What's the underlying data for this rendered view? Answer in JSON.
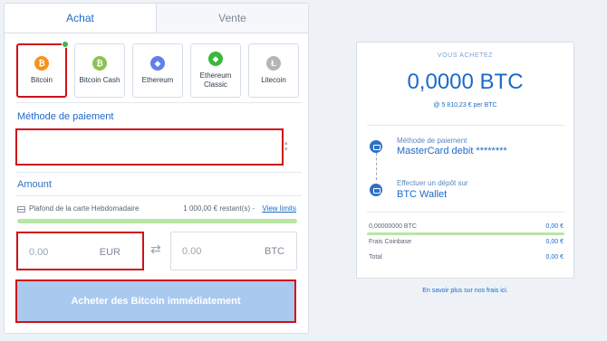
{
  "tabs": {
    "buy": "Achat",
    "sell": "Vente"
  },
  "coins": [
    {
      "label": "Bitcoin",
      "symbol": "₿",
      "color": "#f7931a",
      "selected": true
    },
    {
      "label": "Bitcoin Cash",
      "symbol": "₿",
      "color": "#8dc351",
      "selected": false
    },
    {
      "label": "Ethereum",
      "symbol": "◆",
      "color": "#627eea",
      "selected": false
    },
    {
      "label": "Ethereum Classic",
      "symbol": "◆",
      "color": "#3ab83a",
      "selected": false
    },
    {
      "label": "Litecoin",
      "symbol": "Ł",
      "color": "#b5b5b5",
      "selected": false
    }
  ],
  "payment": {
    "label": "Méthode de paiement",
    "value": ""
  },
  "amount": {
    "label": "Amount",
    "limit_label": "Plafond de la carte Hebdomadaire",
    "limit_amount": "1 000,00 € restant(s) -",
    "view_limits": "View limits",
    "limit_remaining_fraction": 1.0,
    "eur_value": "0.00",
    "eur_currency": "EUR",
    "btc_value": "0.00",
    "btc_currency": "BTC"
  },
  "buy_button": "Acheter des Bitcoin immédiatement",
  "summary": {
    "header": "VOUS ACHETEZ",
    "amount": "0,0000 BTC",
    "rate": "@ 5 810,23 € per BTC",
    "payment_title": "Méthode de paiement",
    "payment_value": "MasterCard debit ********",
    "deposit_title": "Effectuer un dépôt sur",
    "deposit_value": "BTC Wallet",
    "rows": [
      {
        "label": "0,00000000 BTC",
        "value": "0,00 €"
      },
      {
        "label": "Frais Coinbase",
        "value": "0,00 €"
      },
      {
        "label": "Total",
        "value": "0,00 €"
      }
    ]
  },
  "fees_link": "En savoir plus sur nos frais ici."
}
